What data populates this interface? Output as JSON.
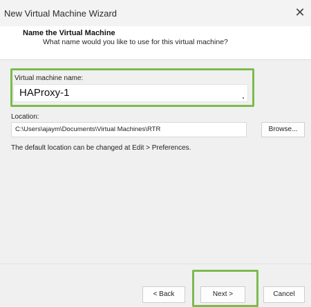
{
  "window": {
    "title": "New Virtual Machine Wizard",
    "close_glyph": "✕"
  },
  "header": {
    "title": "Name the Virtual Machine",
    "subtitle": "What name would you like to use for this virtual machine?"
  },
  "form": {
    "name_label": "Virtual machine name:",
    "name_value": "HAProxy-1",
    "location_label": "Location:",
    "location_value": "C:\\Users\\ajaym\\Documents\\Virtual Machines\\RTR",
    "browse_label": "Browse...",
    "hint": "The default location can be changed at Edit > Preferences."
  },
  "footer": {
    "back_label": "< Back",
    "next_label": "Next >",
    "cancel_label": "Cancel"
  },
  "colors": {
    "highlight": "#7cbb4e",
    "body_bg": "#f0f0f0"
  },
  "icons": [
    "close-icon"
  ]
}
